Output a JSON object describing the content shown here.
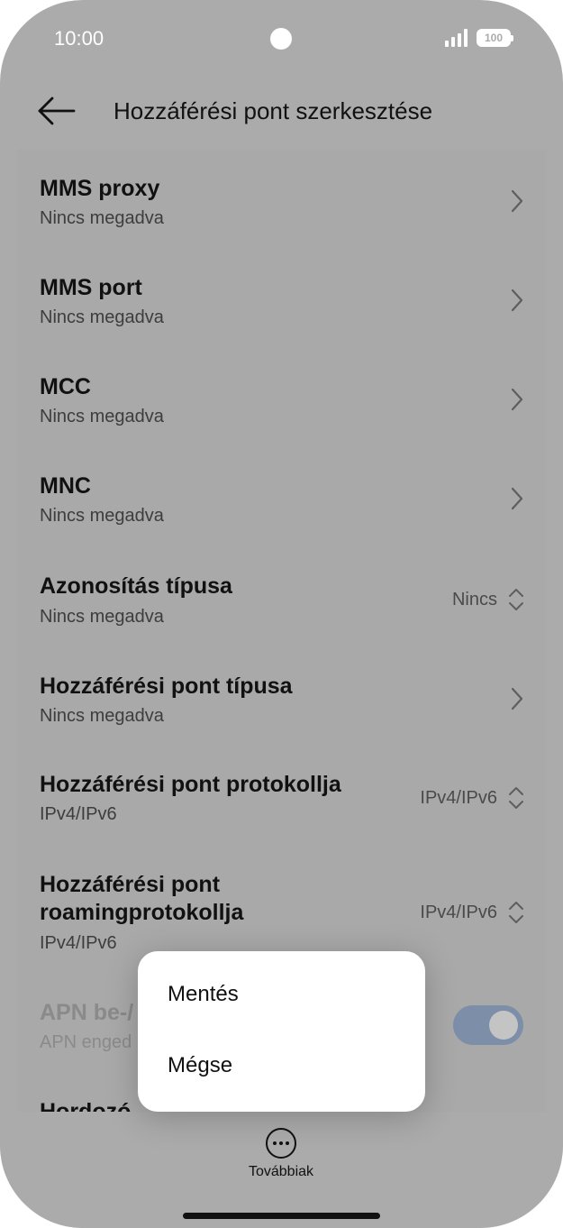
{
  "status_bar": {
    "time": "10:00",
    "battery": "100",
    "icons": [
      "signal-icon",
      "battery-icon",
      "camera-dot"
    ]
  },
  "header": {
    "title": "Hozzáférési pont szerkesztése",
    "back_icon": "arrow-left-icon"
  },
  "list": {
    "items": [
      {
        "title": "MMS proxy",
        "subtitle": "Nincs megadva",
        "value": "",
        "control": "chevron-right-icon"
      },
      {
        "title": "MMS port",
        "subtitle": "Nincs megadva",
        "value": "",
        "control": "chevron-right-icon"
      },
      {
        "title": "MCC",
        "subtitle": "Nincs megadva",
        "value": "",
        "control": "chevron-right-icon"
      },
      {
        "title": "MNC",
        "subtitle": "Nincs megadva",
        "value": "",
        "control": "chevron-right-icon"
      },
      {
        "title": "Azonosítás típusa",
        "subtitle": "Nincs megadva",
        "value": "Nincs",
        "control": "updown-icon"
      },
      {
        "title": "Hozzáférési pont típusa",
        "subtitle": "Nincs megadva",
        "value": "",
        "control": "chevron-right-icon"
      },
      {
        "title": "Hozzáférési pont protokollja",
        "subtitle": "IPv4/IPv6",
        "value": "IPv4/IPv6",
        "control": "updown-icon"
      },
      {
        "title_line1": "Hozzáférési pont",
        "title_line2": "roamingprotokollja",
        "subtitle": "IPv4/IPv6",
        "value": "IPv4/IPv6",
        "control": "updown-icon"
      },
      {
        "title": "APN be-/",
        "subtitle": "APN enged",
        "control": "toggle",
        "toggle_on": true,
        "disabled": true
      },
      {
        "title": "Hordozó",
        "subtitle": "",
        "control": "none"
      }
    ]
  },
  "popup": {
    "items": [
      "Mentés",
      "Mégse"
    ]
  },
  "bottom_bar": {
    "more_label": "Továbbiak",
    "more_icon": "more-horizontal-icon"
  },
  "colors": {
    "background_scrim": "#ababab",
    "text_primary": "#111111",
    "text_secondary": "#3d3d3d",
    "toggle_on": "#7d8ea9",
    "popup_bg": "#ffffff"
  }
}
